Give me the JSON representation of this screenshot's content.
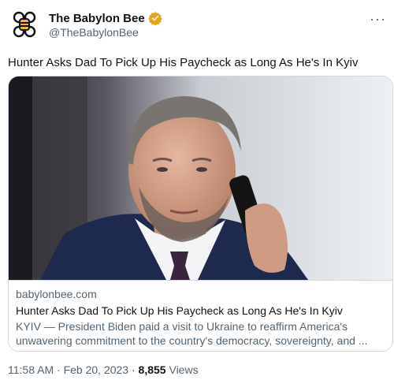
{
  "account": {
    "display_name": "The Babylon Bee",
    "handle": "@TheBabylonBee",
    "avatar_icon": "bee-logo-icon",
    "verified_icon": "verified-gold-badge-icon",
    "brand_color": "#f4b32c",
    "verified_color": "#e8a317"
  },
  "menu": {
    "more_label": "···"
  },
  "tweet": {
    "text": "Hunter Asks Dad To Pick Up His Paycheck as Long As He's In Kyiv"
  },
  "card": {
    "image_description_icon": "photo-man-on-phone",
    "domain": "babylonbee.com",
    "title": "Hunter Asks Dad To Pick Up His Paycheck as Long As He's In Kyiv",
    "description": "KYIV — President Biden paid a visit to Ukraine to reaffirm America's\nunwavering commitment to the country's democracy, sovereignty, and ..."
  },
  "meta": {
    "time": "11:58 AM",
    "separator": " · ",
    "date": "Feb 20, 2023",
    "views_count": "8,855",
    "views_label": " Views"
  }
}
